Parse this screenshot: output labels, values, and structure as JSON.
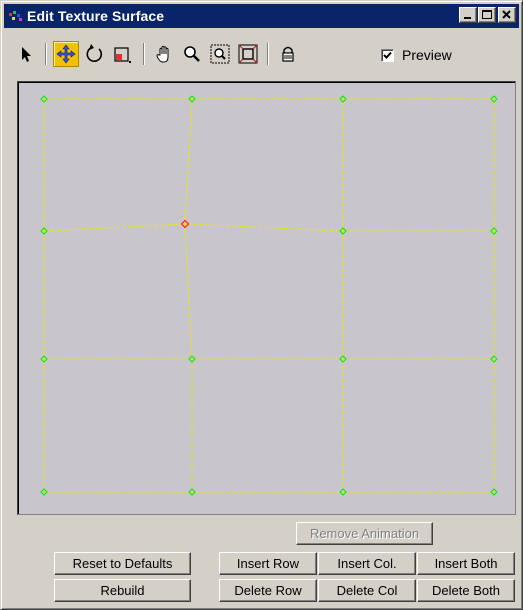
{
  "window": {
    "title": "Edit Texture Surface"
  },
  "toolbar": {
    "tools": [
      "select-icon",
      "move-icon",
      "rotate-icon",
      "scale-icon",
      "pan-icon",
      "zoom-icon",
      "zoom-region-icon",
      "zoom-extents-icon",
      "lock-icon"
    ],
    "active_tool": "move-icon",
    "preview_label": "Preview",
    "preview_checked": true
  },
  "colors": {
    "grid_line": "#e8e800",
    "vertex": "#00ee00",
    "selected_vertex": "#ff2020",
    "canvas_bg": "#c8c5cd",
    "title_bar": "#0a246a"
  },
  "buttons": {
    "remove_animation": "Remove Animation",
    "reset_to_defaults": "Reset to Defaults",
    "rebuild": "Rebuild",
    "insert_row": "Insert Row",
    "insert_col": "Insert Col.",
    "insert_both": "Insert Both",
    "delete_row": "Delete Row",
    "delete_col": "Delete Col",
    "delete_both": "Delete Both"
  }
}
